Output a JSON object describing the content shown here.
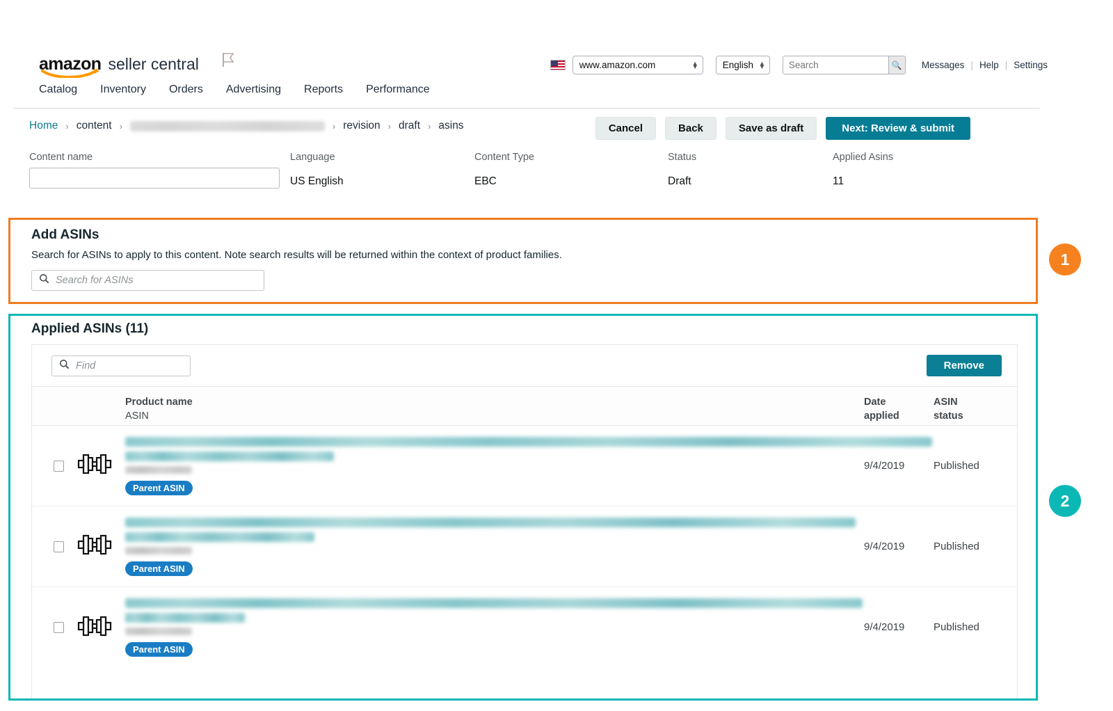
{
  "header": {
    "brand_amazon": "amazon",
    "brand_seller": "seller central",
    "flag_icon": "flag-icon",
    "marketplace_flag": "us-flag-icon",
    "marketplace": "www.amazon.com",
    "language": "English",
    "search_placeholder": "Search",
    "search_value": "",
    "search_icon": "search-icon",
    "links": [
      "Messages",
      "Help",
      "Settings"
    ],
    "nav": [
      "Catalog",
      "Inventory",
      "Orders",
      "Advertising",
      "Reports",
      "Performance"
    ]
  },
  "breadcrumb": {
    "items": [
      {
        "label": "Home",
        "link": true
      },
      {
        "label": "content",
        "link": false
      },
      {
        "label": "",
        "redacted": true
      },
      {
        "label": "revision",
        "link": false
      },
      {
        "label": "draft",
        "link": false
      },
      {
        "label": "asins",
        "link": false
      }
    ],
    "separator": "›"
  },
  "actions": {
    "cancel": "Cancel",
    "back": "Back",
    "save_as_draft": "Save as draft",
    "next": "Next: Review & submit"
  },
  "meta": {
    "content_name_label": "Content name",
    "content_name_value": "",
    "language_label": "Language",
    "language_value": "US English",
    "content_type_label": "Content Type",
    "content_type_value": "EBC",
    "status_label": "Status",
    "status_value": "Draft",
    "applied_asins_label": "Applied Asins",
    "applied_asins_value": "11"
  },
  "add_asins": {
    "title": "Add ASINs",
    "description": "Search for ASINs to apply to this content. Note search results will be returned within the context of product families.",
    "search_placeholder": "Search for ASINs",
    "search_value": "",
    "search_icon": "search-icon"
  },
  "applied_asins": {
    "title": "Applied ASINs (11)",
    "find_placeholder": "Find",
    "find_value": "",
    "find_icon": "search-icon",
    "remove_label": "Remove",
    "columns": {
      "product_name": "Product name",
      "asin": "ASIN",
      "date_applied_line1": "Date",
      "date_applied_line2": "applied",
      "asin_status_line1": "ASIN",
      "asin_status_line2": "status"
    },
    "rows": [
      {
        "icon": "dumbbell-icon",
        "checked": false,
        "name_redacted": true,
        "name_lines": [
          1160,
          300
        ],
        "asin_redacted": true,
        "badge": "Parent ASIN",
        "date_applied": "9/4/2019",
        "status": "Published"
      },
      {
        "icon": "dumbbell-icon",
        "checked": false,
        "name_redacted": true,
        "name_lines": [
          1050,
          272
        ],
        "asin_redacted": true,
        "badge": "Parent ASIN",
        "date_applied": "9/4/2019",
        "status": "Published"
      },
      {
        "icon": "dumbbell-icon",
        "checked": false,
        "name_redacted": true,
        "name_lines": [
          1060,
          172
        ],
        "asin_redacted": true,
        "badge": "Parent ASIN",
        "date_applied": "9/4/2019",
        "status": "Published"
      }
    ]
  },
  "annotations": [
    {
      "number": "1",
      "color": "#f5821f"
    },
    {
      "number": "2",
      "color": "#0cb8b6"
    }
  ],
  "colors": {
    "orange_highlight": "#ef7c1f",
    "teal_highlight": "#0cb8b6",
    "primary_button": "#067d95",
    "badge_blue": "#1a7dc4",
    "link_teal": "#0d7c8c"
  }
}
